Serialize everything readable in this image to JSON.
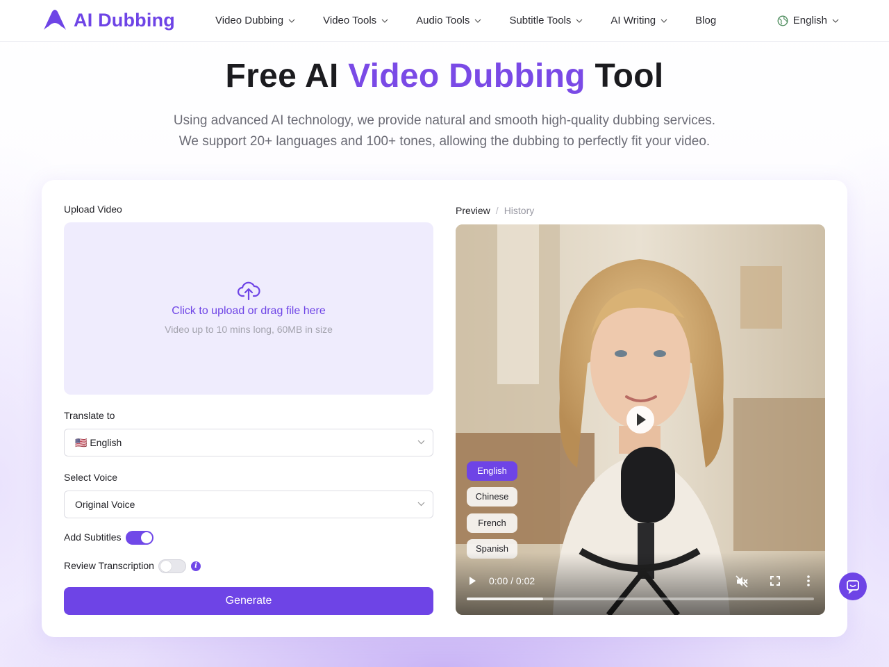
{
  "brand": {
    "name": "AI Dubbing",
    "color": "#6e44e6"
  },
  "nav": {
    "items": [
      {
        "label": "Video Dubbing",
        "has_dropdown": true
      },
      {
        "label": "Video Tools",
        "has_dropdown": true
      },
      {
        "label": "Audio Tools",
        "has_dropdown": true
      },
      {
        "label": "Subtitle Tools",
        "has_dropdown": true
      },
      {
        "label": "AI Writing",
        "has_dropdown": true
      },
      {
        "label": "Blog",
        "has_dropdown": false
      }
    ],
    "language": "English"
  },
  "hero": {
    "title_prefix": "Free AI",
    "title_accent": "Video Dubbing",
    "title_suffix": "Tool",
    "subtitle_line1": "Using advanced AI technology, we provide natural and smooth high-quality dubbing services.",
    "subtitle_line2": "We support 20+ languages and 100+ tones, allowing the dubbing to perfectly fit your video."
  },
  "form": {
    "upload_label": "Upload Video",
    "upload_text": "Click to upload or drag file here",
    "upload_hint": "Video up to 10 mins long, 60MB in size",
    "translate_label": "Translate to",
    "translate_value": "🇺🇸 English",
    "voice_label": "Select Voice",
    "voice_value": "Original Voice",
    "subtitles_label": "Add Subtitles",
    "subtitles_on": true,
    "review_label": "Review Transcription",
    "review_on": false,
    "generate_label": "Generate"
  },
  "preview": {
    "tab_preview": "Preview",
    "tab_separator": "/",
    "tab_history": "History",
    "languages": [
      "English",
      "Chinese",
      "French",
      "Spanish"
    ],
    "active_language": "English",
    "time": "0:00 / 0:02",
    "buffered_fraction": 0.22,
    "muted": true
  }
}
